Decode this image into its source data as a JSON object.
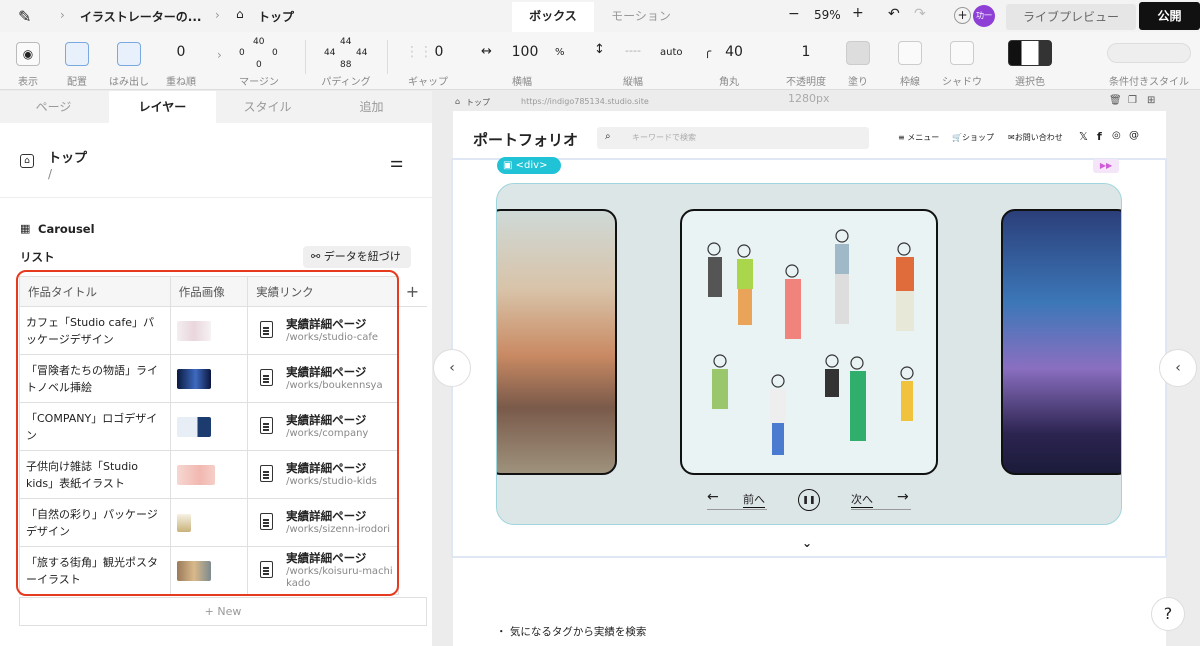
{
  "topbar": {
    "breadcrumb_site": "イラストレーターの...",
    "breadcrumb_page": "トップ",
    "tab_box": "ボックス",
    "tab_motion": "モーション",
    "zoom": "59%",
    "avatar": "功一",
    "preview": "ライブプレビュー",
    "publish": "公開"
  },
  "toolbar": {
    "display": "表示",
    "placement": "配置",
    "overflow": "はみ出し",
    "zorder_val": "0",
    "zorder": "重ね順",
    "margin_top": "40",
    "margin_left": "0",
    "margin_right": "0",
    "margin_bottom": "0",
    "margin": "マージン",
    "padding_top": "44",
    "padding_left": "44",
    "padding_right": "44",
    "padding_bottom": "88",
    "padding": "パディング",
    "gap_val": "0",
    "gap": "ギャップ",
    "width_val": "100",
    "width_unit": "%",
    "width": "横幅",
    "height_val": "----",
    "height_unit": "auto",
    "height": "縦幅",
    "radius_val": "40",
    "radius": "角丸",
    "opacity_val": "1",
    "opacity": "不透明度",
    "fill": "塗り",
    "border": "枠線",
    "shadow": "シャドウ",
    "selected_color": "選択色",
    "conditional_style": "条件付きスタイル"
  },
  "leftpanel": {
    "tabs": [
      "ページ",
      "レイヤー",
      "スタイル",
      "追加"
    ],
    "page_name": "トップ",
    "page_path": "/",
    "component": "Carousel",
    "list_label": "リスト",
    "bind_button": "データを紐づけ",
    "columns": [
      "作品タイトル",
      "作品画像",
      "実績リンク"
    ],
    "rows": [
      {
        "title": "カフェ「Studio cafe」パッケージデザイン",
        "link": "実績詳細ページ",
        "url": "/works/studio-cafe"
      },
      {
        "title": "「冒険者たちの物語」ライトノベル挿絵",
        "link": "実績詳細ページ",
        "url": "/works/boukennsya"
      },
      {
        "title": "「COMPANY」ロゴデザイン",
        "link": "実績詳細ページ",
        "url": "/works/company"
      },
      {
        "title": "子供向け雑誌「Studio kids」表紙イラスト",
        "link": "実績詳細ページ",
        "url": "/works/studio-kids"
      },
      {
        "title": "「自然の彩り」パッケージデザイン",
        "link": "実績詳細ページ",
        "url": "/works/sizenn-irodori"
      },
      {
        "title": "「旅する街角」観光ポスターイラスト",
        "link": "実績詳細ページ",
        "url": "/works/koisuru-machikado"
      }
    ],
    "new_button": "+ New"
  },
  "canvas": {
    "page_tab": "トップ",
    "url": "https://indigo785134.studio.site",
    "width_label": "1280px",
    "logo": "ポートフォリオ",
    "search_placeholder": "キーワードで検索",
    "menu": "メニュー",
    "shop": "ショップ",
    "contact": "お問い合わせ",
    "div_tag": "<div>",
    "prev": "前へ",
    "next": "次へ",
    "search_heading": "気になるタグから実績を検索"
  }
}
